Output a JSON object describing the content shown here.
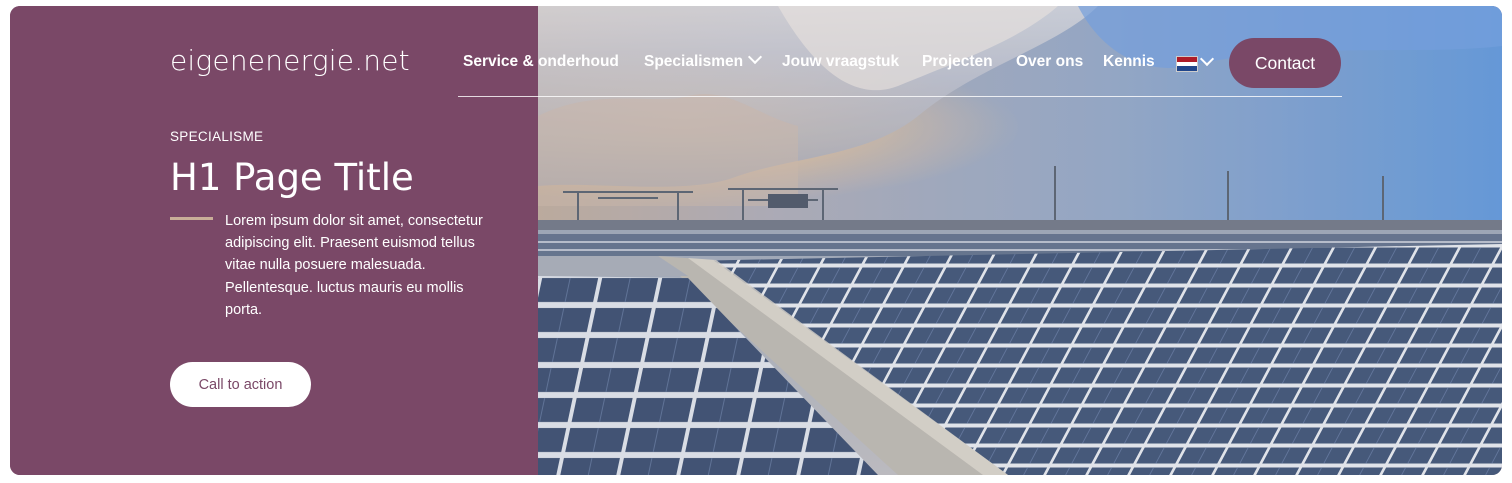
{
  "brand": {
    "logo_text": "eigenenergie.net"
  },
  "nav": {
    "items": [
      {
        "label": "Service & onderhoud"
      },
      {
        "label": "Specialismen"
      },
      {
        "label": "Jouw vraagstuk"
      },
      {
        "label": "Projecten"
      },
      {
        "label": "Over ons"
      },
      {
        "label": "Kennis"
      }
    ],
    "language_flag": "netherlands-flag-icon",
    "contact_label": "Contact"
  },
  "hero": {
    "eyebrow": "SPECIALISME",
    "title": "H1 Page Title",
    "intro": "Lorem ipsum dolor sit amet, consectetur adipiscing elit. Praesent euismod tellus vitae nulla posuere malesuada. Pellentesque. luctus mauris eu mollis porta.",
    "cta_label": "Call to action"
  },
  "colors": {
    "brand_purple": "#7a4867",
    "accent_beige": "#c9ae98",
    "white": "#ffffff"
  }
}
